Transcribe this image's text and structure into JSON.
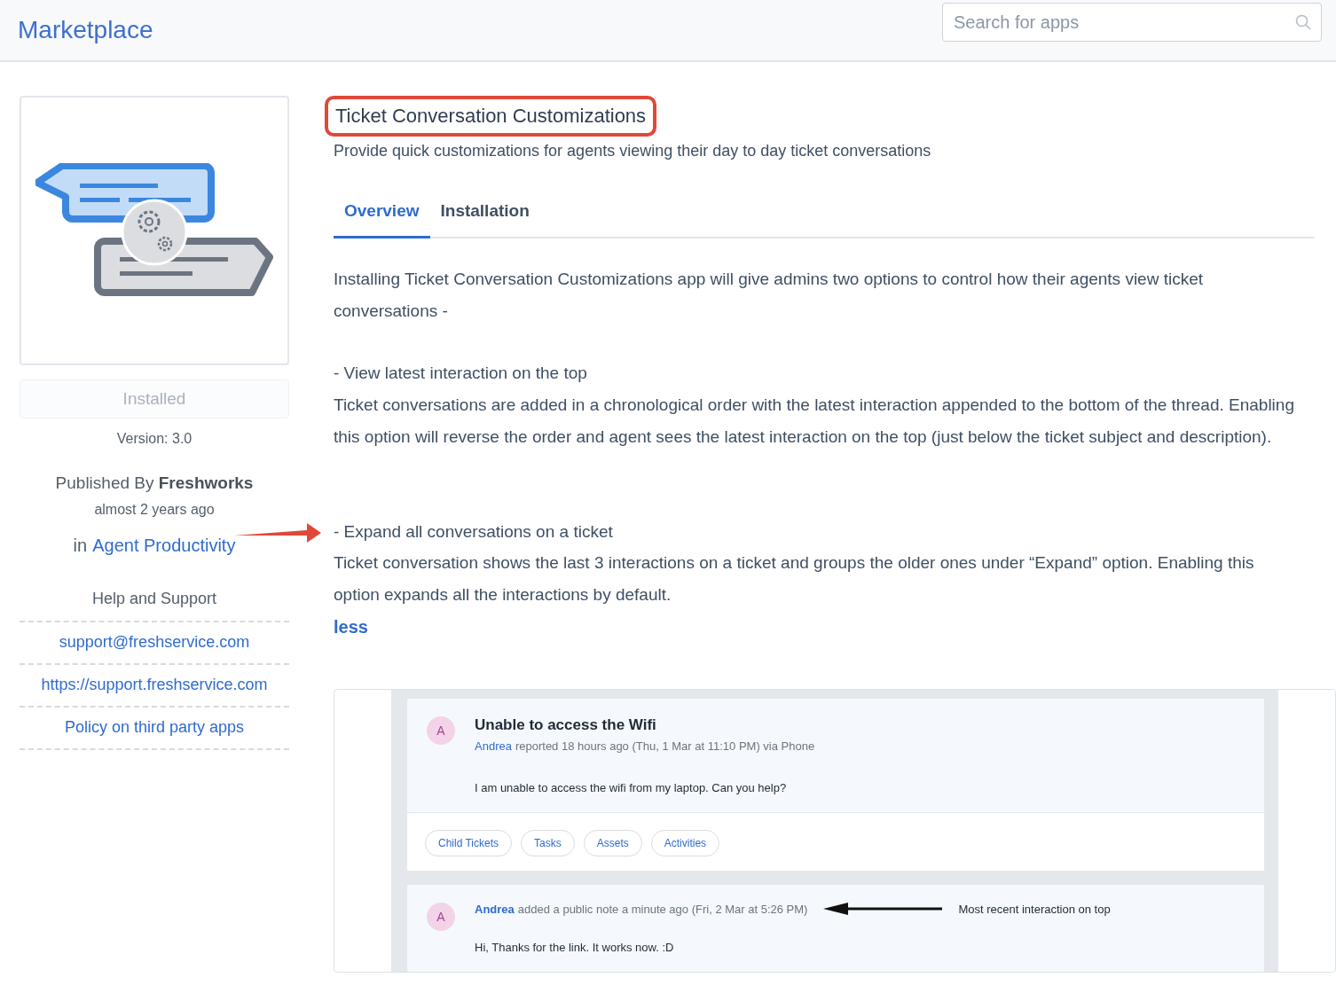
{
  "header": {
    "title": "Marketplace",
    "search": {
      "placeholder": "Search for apps"
    }
  },
  "sidebar": {
    "install_button": {
      "label": "Installed",
      "disabled": true
    },
    "version": "Version: 3.0",
    "published": "Published By **Freshworks**",
    "published_time": "almost 2 years ago",
    "category": {
      "prefix": "in",
      "link": "Agent Productivity"
    },
    "help_heading": "Help and Support",
    "links": [
      "support@freshservice.com",
      "https://support.freshservice.com",
      "Policy on third party apps"
    ]
  },
  "app": {
    "title": "Ticket Conversation Customizations",
    "title_highlighted": true,
    "subtitle": "Provide quick customizations for agents viewing their day to day ticket conversations",
    "tabs": [
      {
        "label": "Overview",
        "selected": true
      },
      {
        "label": "Installation",
        "selected": false
      }
    ],
    "description": [
      {
        "kind": "text",
        "text": "Installing Ticket Conversation Customizations app will give admins two options to control how their agents view ticket conversations -"
      },
      {
        "kind": "heading",
        "text": "- View latest interaction on the top"
      },
      {
        "kind": "text",
        "text": "Ticket conversations are added in a chronological order with the latest interaction appended to the bottom of the thread. Enabling this option will reverse the order and agent sees the latest interaction on the top (just below the ticket subject and description)."
      },
      {
        "kind": "pointed_heading",
        "text": "- Expand all conversations on a ticket"
      },
      {
        "kind": "text",
        "text": "Ticket conversation shows the last 3 interactions on a ticket and groups the older ones under “Expand” option. Enabling this option expands all the interactions by default."
      },
      {
        "kind": "link",
        "text": "less"
      }
    ],
    "screenshot": {
      "ticket": {
        "avatar": "A",
        "title": "Unable to access the Wifi",
        "author": "Andrea",
        "meta": "reported 18 hours ago (Thu, 1 Mar at 11:10 PM) via Phone",
        "body": "I am unable to access the wifi from my laptop. Can you help?",
        "pills": [
          "Child Tickets",
          "Tasks",
          "Assets",
          "Activities"
        ]
      },
      "note": {
        "avatar": "A",
        "author": "Andrea",
        "meta": "added a public note a minute ago (Fri, 2 Mar at 5:26 PM)",
        "annotation": "Most recent interaction on top",
        "body": "Hi, Thanks for the link. It works now. :D"
      }
    }
  }
}
